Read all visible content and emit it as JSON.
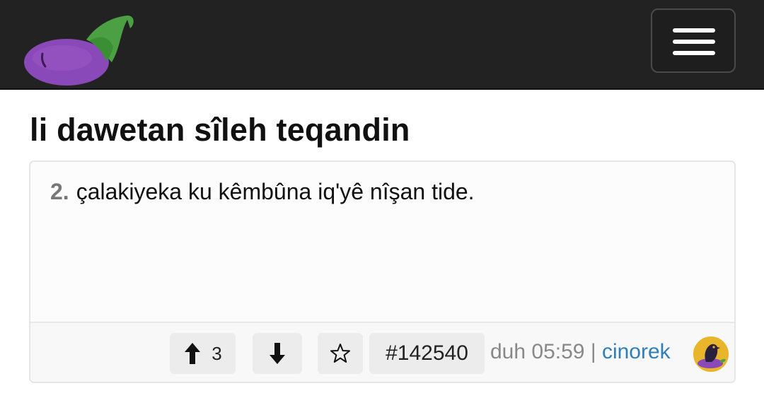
{
  "header": {
    "logo_icon": "eggplant-icon",
    "menu_icon": "hamburger-icon"
  },
  "page": {
    "title": "li dawetan sîleh teqandin"
  },
  "post": {
    "number": "2.",
    "text": "çalakiyeka ku kêmbûna iq'yê nîşan tide.",
    "upvote_icon": "arrow-up-icon",
    "upvote_count": "3",
    "downvote_icon": "arrow-down-icon",
    "favorite_icon": "star-outline-icon",
    "id": "#142540",
    "time": "duh 05:59",
    "separator": "|",
    "author": "cinorek",
    "avatar_icon": "crow-eggplant-avatar"
  },
  "colors": {
    "navbar": "#222222",
    "eggplant": "#8a49b8",
    "stem": "#4aa043",
    "author_link": "#2f7fb8",
    "avatar_bg": "#e9b52a"
  }
}
